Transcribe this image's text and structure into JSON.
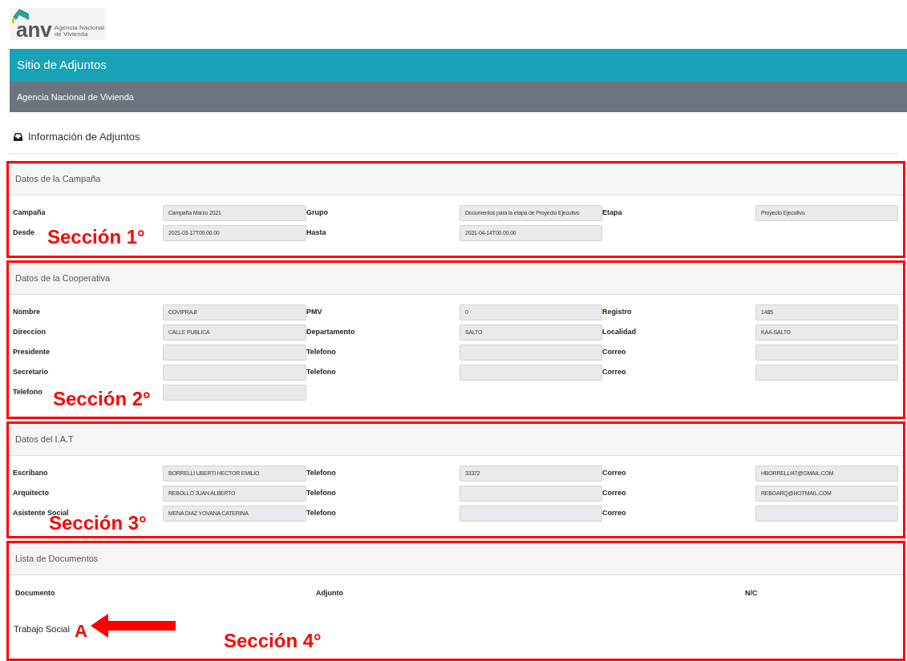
{
  "logo": {
    "short": "anv",
    "line_1": "Agencia Nacional",
    "line_2": "de Vivienda"
  },
  "header": {
    "title": "Sitio de Adjuntos",
    "subtitle": "Agencia Nacional de Vivienda"
  },
  "page_title": "Información de Adjuntos",
  "sections": [
    {
      "title": "Datos de la Campaña",
      "annotation": "Sección 1°",
      "rows": [
        [
          {
            "label": "Campaña",
            "value": "Campaña Marzo 2021"
          },
          {
            "label": "Grupo",
            "value": "Documentos para la etapa de Proyecto Ejecutivo"
          },
          {
            "label": "Etapa",
            "value": "Proyecto Ejecutivo"
          }
        ],
        [
          {
            "label": "Desde",
            "value": "2021-03-17T00.00.00"
          },
          {
            "label": "Hasta",
            "value": "2021-04-14T00.00.00"
          }
        ]
      ]
    },
    {
      "title": "Datos de la Cooperativa",
      "annotation": "Sección 2°",
      "rows": [
        [
          {
            "label": "Nombre",
            "value": "COVIPRA 8"
          },
          {
            "label": "PMV",
            "value": "0"
          },
          {
            "label": "Registro",
            "value": "1485"
          }
        ],
        [
          {
            "label": "Direccion",
            "value": "CALLE PUBLICA"
          },
          {
            "label": "Departamento",
            "value": "SALTO"
          },
          {
            "label": "Localidad",
            "value": "KAA-SALTO"
          }
        ],
        [
          {
            "label": "Presidente"
          },
          {
            "label": "Telefono"
          },
          {
            "label": "Correo"
          }
        ],
        [
          {
            "label": "Secretario"
          },
          {
            "label": "Telefono"
          },
          {
            "label": "Correo"
          }
        ],
        [
          {
            "label": "Telefono"
          }
        ]
      ]
    },
    {
      "title": "Datos del I.A.T",
      "annotation": "Sección 3°",
      "rows": [
        [
          {
            "label": "Escribano",
            "value": "BORRELLI UBERTI HECTOR EMILIO"
          },
          {
            "label": "Telefono",
            "value": "33372"
          },
          {
            "label": "Correo",
            "value": "HBORRELLI47@GMAIL.COM"
          }
        ],
        [
          {
            "label": "Arquitecto",
            "value": "REBOLLO JUAN ALBERTO"
          },
          {
            "label": "Telefono"
          },
          {
            "label": "Correo",
            "value": "REBOARQ@HOTMAIL.COM"
          }
        ],
        [
          {
            "label": "Asistente Social",
            "value": "MENA DIAZ YOVANA CATERINA"
          },
          {
            "label": "Telefono"
          },
          {
            "label": "Correo"
          }
        ]
      ]
    }
  ],
  "documents": {
    "title": "Lista de Documentos",
    "annotation": "Sección 4°",
    "columns": [
      "Documento",
      "Adjunto",
      "N/C"
    ],
    "rows": [
      {
        "document": "Trabajo Social",
        "marker": "A"
      }
    ]
  }
}
